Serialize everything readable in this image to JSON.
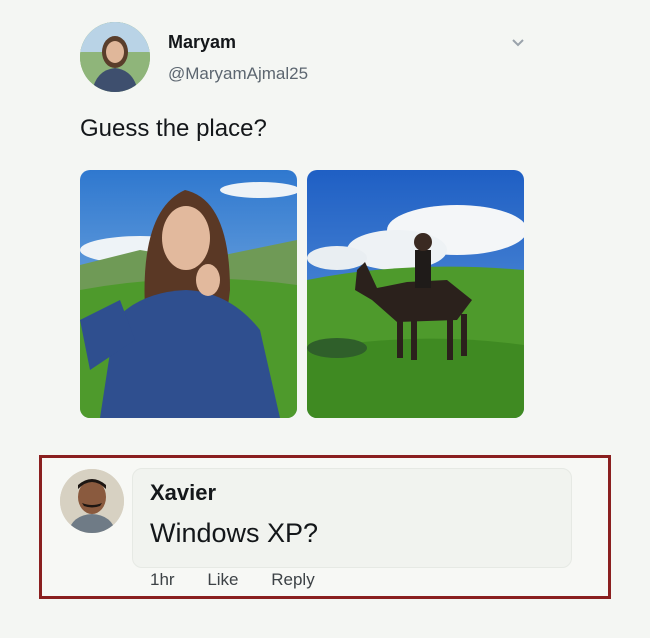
{
  "tweet": {
    "display_name": "Maryam",
    "handle": "@MaryamAjmal25",
    "text": "Guess the place?"
  },
  "comment": {
    "name": "Xavier",
    "text": "Windows XP?",
    "time": "1hr",
    "like_label": "Like",
    "reply_label": "Reply"
  },
  "colors": {
    "sky": "#3f86d6",
    "grass": "#4e9a2c",
    "highlight_border": "#8a1f1f"
  },
  "icons": {
    "menu": "chevron-down-icon"
  }
}
